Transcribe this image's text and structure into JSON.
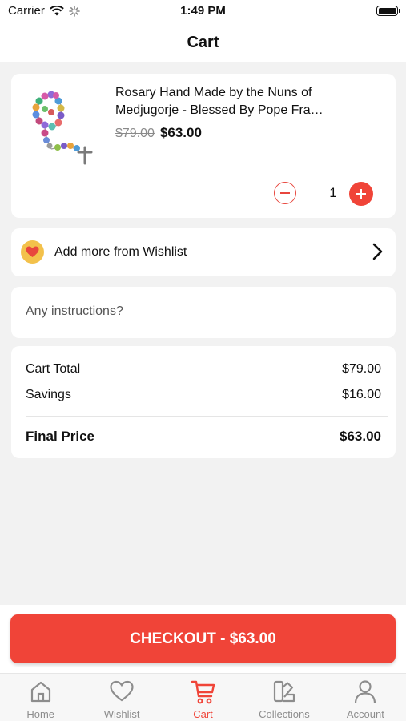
{
  "status_bar": {
    "carrier": "Carrier",
    "time": "1:49 PM"
  },
  "header": {
    "title": "Cart"
  },
  "cart": {
    "items": [
      {
        "title": "Rosary Hand Made by the Nuns of Medjugorje - Blessed By Pope Fra…",
        "original_price": "$79.00",
        "sale_price": "$63.00",
        "quantity": "1"
      }
    ]
  },
  "wishlist": {
    "label": "Add more from Wishlist"
  },
  "instructions": {
    "placeholder": "Any instructions?"
  },
  "summary": {
    "cart_total_label": "Cart Total",
    "cart_total_value": "$79.00",
    "savings_label": "Savings",
    "savings_value": "$16.00",
    "final_label": "Final Price",
    "final_value": "$63.00"
  },
  "checkout": {
    "label": "CHECKOUT - $63.00"
  },
  "tab_bar": {
    "tabs": [
      {
        "label": "Home",
        "icon": "home-icon"
      },
      {
        "label": "Wishlist",
        "icon": "heart-icon"
      },
      {
        "label": "Cart",
        "icon": "cart-icon",
        "active": true
      },
      {
        "label": "Collections",
        "icon": "collections-icon"
      },
      {
        "label": "Account",
        "icon": "person-icon"
      }
    ]
  },
  "colors": {
    "accent": "#f04438",
    "background": "#f2f2f2",
    "wishlist_badge": "#f3c14b"
  }
}
